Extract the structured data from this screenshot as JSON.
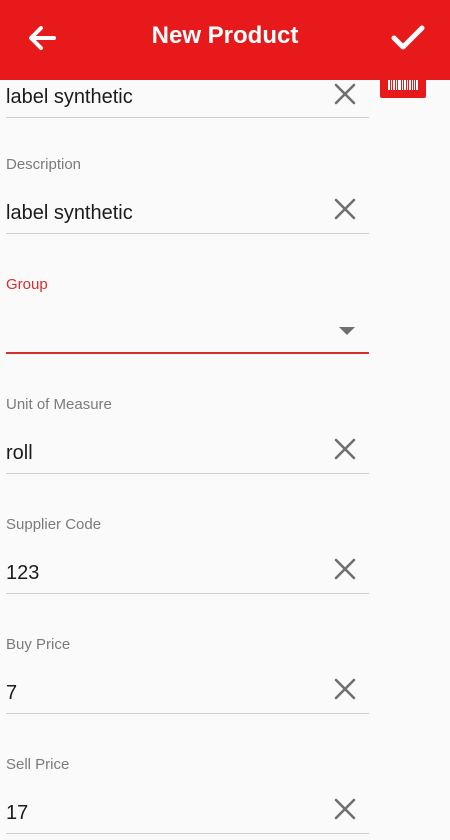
{
  "appbar": {
    "title": "New Product",
    "back_icon": "arrow-left-icon",
    "save_icon": "check-icon",
    "color": "#e8191b"
  },
  "barcode_button": {
    "icon": "barcode-icon"
  },
  "fields": {
    "name": {
      "label": "",
      "value": "label synthetic"
    },
    "description": {
      "label": "Description",
      "value": "label synthetic"
    },
    "group": {
      "label": "Group",
      "value": ""
    },
    "unit_of_measure": {
      "label": "Unit of Measure",
      "value": "roll"
    },
    "supplier_code": {
      "label": "Supplier Code",
      "value": "123"
    },
    "buy_price": {
      "label": "Buy Price",
      "value": "7"
    },
    "sell_price": {
      "label": "Sell Price",
      "value": "17"
    }
  },
  "colors": {
    "accent": "#d32f2f",
    "label": "#7b7b7b",
    "icon": "#6f6f6f"
  }
}
